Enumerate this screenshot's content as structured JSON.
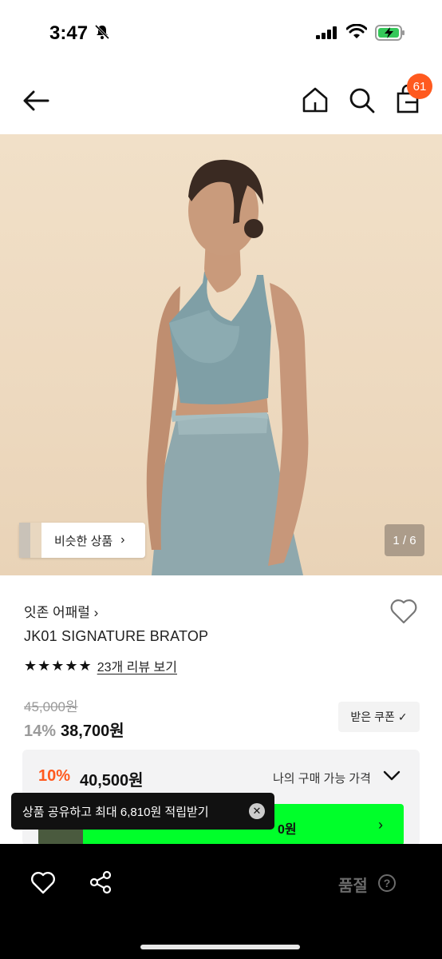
{
  "status_bar": {
    "time": "3:47"
  },
  "header": {
    "cart_count": "61"
  },
  "hero": {
    "similar_label": "비슷한 상품",
    "similar_chevron": "›",
    "page_indicator": "1 / 6"
  },
  "product": {
    "brand": "잇존 어패럴 ›",
    "name": "JK01 SIGNATURE BRATOP",
    "stars": "★★★★★",
    "review_link": "23개 리뷰 보기",
    "original_price": "45,000원",
    "discount_rate": "14%",
    "sale_price": "38,700원",
    "coupon_label": "받은 쿠폰",
    "coupon_check": "✓"
  },
  "best_price": {
    "rate": "10%",
    "price": "40,500원",
    "label": "나의 구매 가능 가격",
    "banner_text": "0원",
    "banner_chevron": "›"
  },
  "toast": {
    "text": "상품 공유하고 최대 6,810원 적립받기",
    "close": "✕"
  },
  "bottom_bar": {
    "soldout_label": "품절",
    "help": "?"
  },
  "colors": {
    "accent": "#ff5a1f",
    "banner": "#00ff2a"
  }
}
